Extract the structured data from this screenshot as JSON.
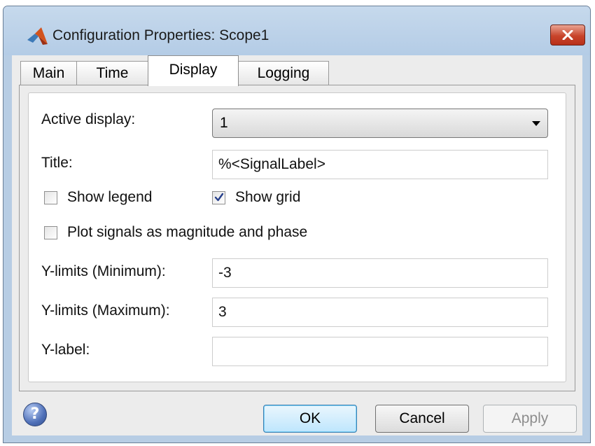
{
  "window": {
    "title": "Configuration Properties: Scope1"
  },
  "tabs": [
    {
      "label": "Main"
    },
    {
      "label": "Time"
    },
    {
      "label": "Display"
    },
    {
      "label": "Logging"
    }
  ],
  "display": {
    "active_display_label": "Active display:",
    "active_display_value": "1",
    "title_label": "Title:",
    "title_value": "%<SignalLabel>",
    "show_legend_label": "Show legend",
    "show_legend_checked": false,
    "show_grid_label": "Show grid",
    "show_grid_checked": true,
    "plot_mag_phase_label": "Plot signals as magnitude and phase",
    "plot_mag_phase_checked": false,
    "ymin_label": "Y-limits (Minimum):",
    "ymin_value": "-3",
    "ymax_label": "Y-limits (Maximum):",
    "ymax_value": "3",
    "ylabel_label": "Y-label:",
    "ylabel_value": ""
  },
  "buttons": {
    "ok": "OK",
    "cancel": "Cancel",
    "apply": "Apply",
    "help": "?"
  },
  "colors": {
    "titlebar": "#b7cde4",
    "close_button": "#c8442b",
    "ok_button": "#bee6fd",
    "matlab_logo": "#d2531e"
  },
  "icons": {
    "app": "matlab-logo-icon",
    "close": "close-icon",
    "help": "help-icon",
    "dropdown": "chevron-down-icon",
    "check": "checkmark-icon"
  }
}
